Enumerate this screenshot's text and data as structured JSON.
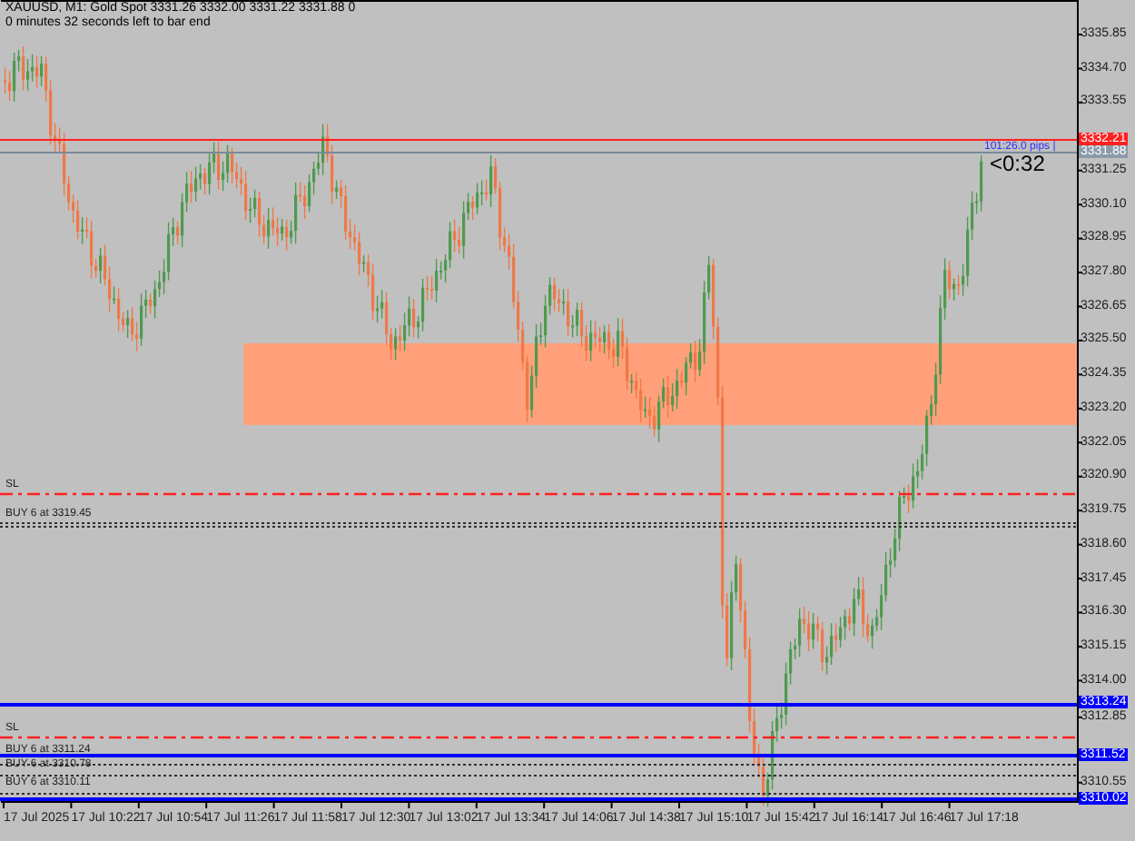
{
  "chart": {
    "header": {
      "symbol_line": "XAUUSD, M1:  Gold Spot  3331.26 3332.00 3331.22 3331.88  0",
      "timer_line": "0 minutes 32 seconds left to bar end"
    },
    "price_axis": [
      "3335.85",
      "3334.70",
      "3333.55",
      "3331.25",
      "3330.10",
      "3328.95",
      "3327.80",
      "3326.65",
      "3325.50",
      "3324.35",
      "3323.20",
      "3322.05",
      "3320.90",
      "3319.75",
      "3318.60",
      "3317.45",
      "3316.30",
      "3315.15",
      "3314.00",
      "3312.85",
      "3310.55"
    ],
    "time_axis": [
      "17 Jul 2025",
      "17 Jul 10:22",
      "17 Jul 10:54",
      "17 Jul 11:26",
      "17 Jul 11:58",
      "17 Jul 12:30",
      "17 Jul 13:02",
      "17 Jul 13:34",
      "17 Jul 14:06",
      "17 Jul 14:38",
      "17 Jul 15:10",
      "17 Jul 15:42",
      "17 Jul 16:14",
      "17 Jul 16:46",
      "17 Jul 17:18"
    ],
    "levels": [
      {
        "kind": "ask"
      },
      {
        "kind": "bid"
      },
      {
        "kind": "sl",
        "label": "SL"
      },
      {
        "kind": "order",
        "label": "BUY 6 at 3319.45"
      },
      {
        "kind": "order"
      },
      {
        "kind": "line"
      },
      {
        "kind": "sl",
        "label": "SL"
      },
      {
        "kind": "line"
      },
      {
        "kind": "order",
        "label": "BUY 6 at 3311.24"
      },
      {
        "kind": "order",
        "label": "BUY 6 at 3310.78"
      },
      {
        "kind": "order",
        "label": "BUY 6 at 3310.11"
      },
      {
        "kind": "line"
      }
    ],
    "price_badges": [
      {
        "kind": "ask",
        "text": "3332.21"
      },
      {
        "kind": "bid",
        "text": "3331.88"
      },
      {
        "kind": "line",
        "text": "3313.24"
      },
      {
        "kind": "line",
        "text": "3311.52"
      },
      {
        "kind": "line",
        "text": "3310.02"
      }
    ],
    "pips_label": "101:26.0 pips |",
    "countdown": "<0:32"
  }
}
